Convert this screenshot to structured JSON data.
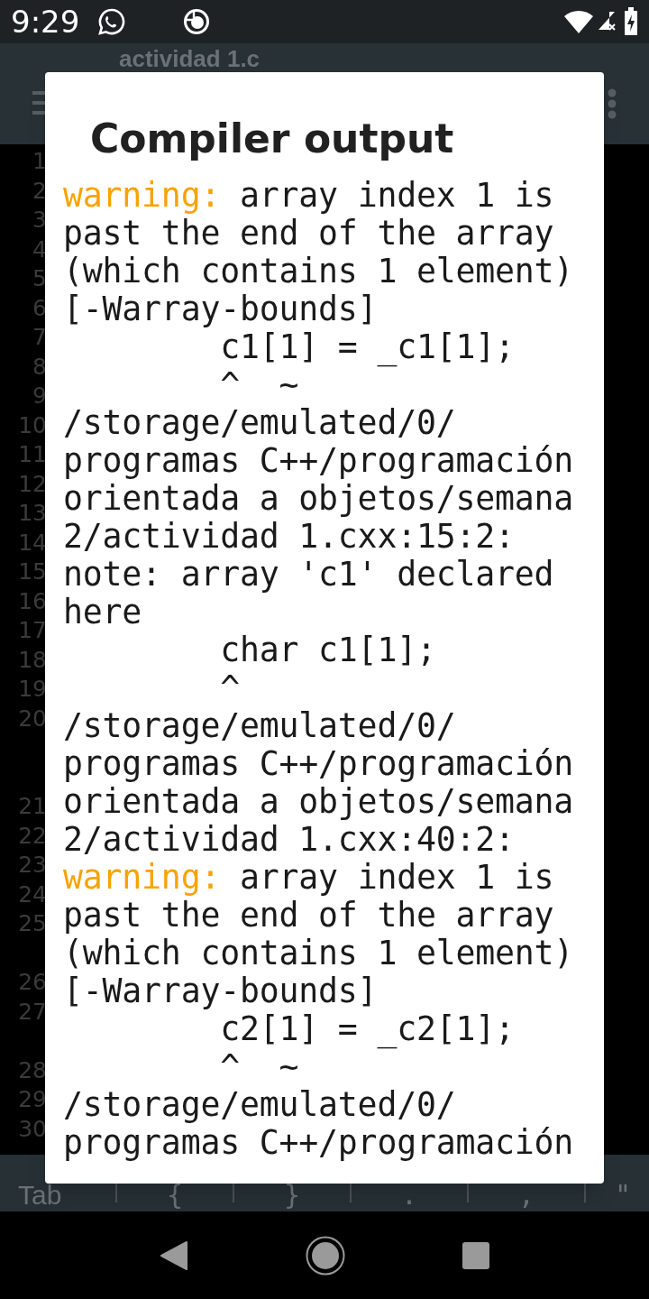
{
  "status_bar": {
    "time": "9:29"
  },
  "toolbar": {
    "title": "actividad 1.c"
  },
  "editor": {
    "gutter": [
      {
        "kind": "line",
        "number": "1"
      },
      {
        "kind": "line",
        "number": "2"
      },
      {
        "kind": "line",
        "number": "3"
      },
      {
        "kind": "line",
        "number": "4"
      },
      {
        "kind": "line",
        "number": "5"
      },
      {
        "kind": "line",
        "number": "6"
      },
      {
        "kind": "line",
        "number": "7"
      },
      {
        "kind": "line",
        "number": "8"
      },
      {
        "kind": "line",
        "number": "9"
      },
      {
        "kind": "line",
        "number": "10"
      },
      {
        "kind": "line",
        "number": "11"
      },
      {
        "kind": "line",
        "number": "12"
      },
      {
        "kind": "line",
        "number": "13"
      },
      {
        "kind": "line",
        "number": "14"
      },
      {
        "kind": "line",
        "number": "15"
      },
      {
        "kind": "line",
        "number": "16"
      },
      {
        "kind": "line",
        "number": "17"
      },
      {
        "kind": "line",
        "number": "18"
      },
      {
        "kind": "line",
        "number": "19"
      },
      {
        "kind": "line",
        "number": "20"
      },
      {
        "kind": "continuation"
      },
      {
        "kind": "continuation"
      },
      {
        "kind": "line",
        "number": "21"
      },
      {
        "kind": "line",
        "number": "22"
      },
      {
        "kind": "line",
        "number": "23"
      },
      {
        "kind": "line",
        "number": "24"
      },
      {
        "kind": "line",
        "number": "25"
      },
      {
        "kind": "continuation"
      },
      {
        "kind": "line",
        "number": "26"
      },
      {
        "kind": "line",
        "number": "27"
      },
      {
        "kind": "continuation"
      },
      {
        "kind": "line",
        "number": "28"
      },
      {
        "kind": "line",
        "number": "29"
      },
      {
        "kind": "line",
        "number": "30"
      }
    ]
  },
  "key_bar": {
    "keys": [
      "Tab",
      "{",
      "}",
      ".",
      ",",
      "\""
    ]
  },
  "dialog": {
    "title": "Compiler output",
    "lines": [
      [
        {
          "kind": "warning",
          "text": "warning:"
        },
        {
          "kind": "plain",
          "text": " array index 1 is"
        }
      ],
      [
        {
          "kind": "plain",
          "text": "past the end of the array"
        }
      ],
      [
        {
          "kind": "plain",
          "text": "(which contains 1 element)"
        }
      ],
      [
        {
          "kind": "plain",
          "text": "[-Warray-bounds]"
        }
      ],
      [
        {
          "kind": "plain",
          "text": "        c1[1] = _c1[1];"
        }
      ],
      [
        {
          "kind": "plain",
          "text": "        ^  ~"
        }
      ],
      [
        {
          "kind": "plain",
          "text": "/storage/emulated/0/"
        }
      ],
      [
        {
          "kind": "plain",
          "text": "programas C++/programación"
        }
      ],
      [
        {
          "kind": "plain",
          "text": "orientada a objetos/semana"
        }
      ],
      [
        {
          "kind": "plain",
          "text": "2/actividad 1.cxx:15:2:"
        }
      ],
      [
        {
          "kind": "plain",
          "text": "note: array 'c1' declared"
        }
      ],
      [
        {
          "kind": "plain",
          "text": "here"
        }
      ],
      [
        {
          "kind": "plain",
          "text": "        char c1[1];"
        }
      ],
      [
        {
          "kind": "plain",
          "text": "        ^"
        }
      ],
      [
        {
          "kind": "plain",
          "text": "/storage/emulated/0/"
        }
      ],
      [
        {
          "kind": "plain",
          "text": "programas C++/programación"
        }
      ],
      [
        {
          "kind": "plain",
          "text": "orientada a objetos/semana"
        }
      ],
      [
        {
          "kind": "plain",
          "text": "2/actividad 1.cxx:40:2:"
        }
      ],
      [
        {
          "kind": "warning",
          "text": "warning:"
        },
        {
          "kind": "plain",
          "text": " array index 1 is"
        }
      ],
      [
        {
          "kind": "plain",
          "text": "past the end of the array"
        }
      ],
      [
        {
          "kind": "plain",
          "text": "(which contains 1 element)"
        }
      ],
      [
        {
          "kind": "plain",
          "text": "[-Warray-bounds]"
        }
      ],
      [
        {
          "kind": "plain",
          "text": "        c2[1] = _c2[1];"
        }
      ],
      [
        {
          "kind": "plain",
          "text": "        ^  ~"
        }
      ],
      [
        {
          "kind": "plain",
          "text": "/storage/emulated/0/"
        }
      ],
      [
        {
          "kind": "plain",
          "text": "programas C++/programación"
        }
      ]
    ]
  }
}
